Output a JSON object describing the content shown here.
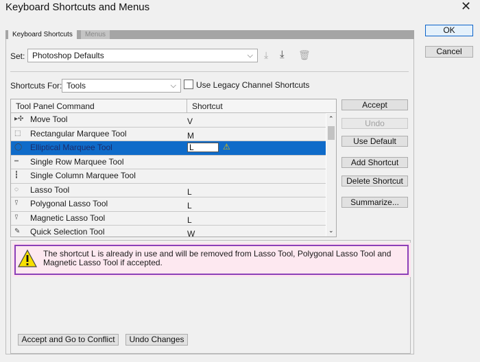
{
  "window": {
    "title": "Keyboard Shortcuts and Menus",
    "close": "✕"
  },
  "buttons": {
    "ok": "OK",
    "cancel": "Cancel"
  },
  "tabs": [
    {
      "label": "Keyboard Shortcuts",
      "active": true
    },
    {
      "label": "Menus",
      "active": false
    }
  ],
  "set": {
    "label": "Set:",
    "value": "Photoshop Defaults"
  },
  "shortcuts_for": {
    "label": "Shortcuts For:",
    "value": "Tools",
    "legacy_label": "Use Legacy Channel Shortcuts",
    "legacy_checked": false
  },
  "table": {
    "headers": [
      "Tool Panel Command",
      "Shortcut"
    ],
    "rows": [
      {
        "icon": "move-tool-icon",
        "glyph": "▸✣",
        "name": "Move Tool",
        "key": "V"
      },
      {
        "icon": "rectangular-marquee-icon",
        "glyph": "⬚",
        "name": "Rectangular Marquee Tool",
        "key": "M"
      },
      {
        "icon": "elliptical-marquee-icon",
        "glyph": "◯",
        "name": "Elliptical Marquee Tool",
        "key": "L",
        "selected": true
      },
      {
        "icon": "single-row-marquee-icon",
        "glyph": "┅",
        "name": "Single Row Marquee Tool",
        "key": ""
      },
      {
        "icon": "single-column-marquee-icon",
        "glyph": "┇",
        "name": "Single Column Marquee Tool",
        "key": ""
      },
      {
        "icon": "lasso-icon",
        "glyph": "◌",
        "name": "Lasso Tool",
        "key": "L"
      },
      {
        "icon": "polygonal-lasso-icon",
        "glyph": "⍢",
        "name": "Polygonal Lasso Tool",
        "key": "L"
      },
      {
        "icon": "magnetic-lasso-icon",
        "glyph": "⍢",
        "name": "Magnetic Lasso Tool",
        "key": "L"
      },
      {
        "icon": "quick-selection-icon",
        "glyph": "✎",
        "name": "Quick Selection Tool",
        "key": "W"
      }
    ]
  },
  "side_buttons": {
    "accept": "Accept",
    "undo": "Undo",
    "use_default": "Use Default",
    "add_shortcut": "Add Shortcut",
    "delete_shortcut": "Delete Shortcut",
    "summarize": "Summarize..."
  },
  "message": "The shortcut L is already in use and will be removed from Lasso Tool, Polygonal Lasso Tool and Magnetic Lasso Tool if accepted.",
  "bottom_buttons": {
    "accept_conflict": "Accept and Go to Conflict",
    "undo_changes": "Undo Changes"
  }
}
